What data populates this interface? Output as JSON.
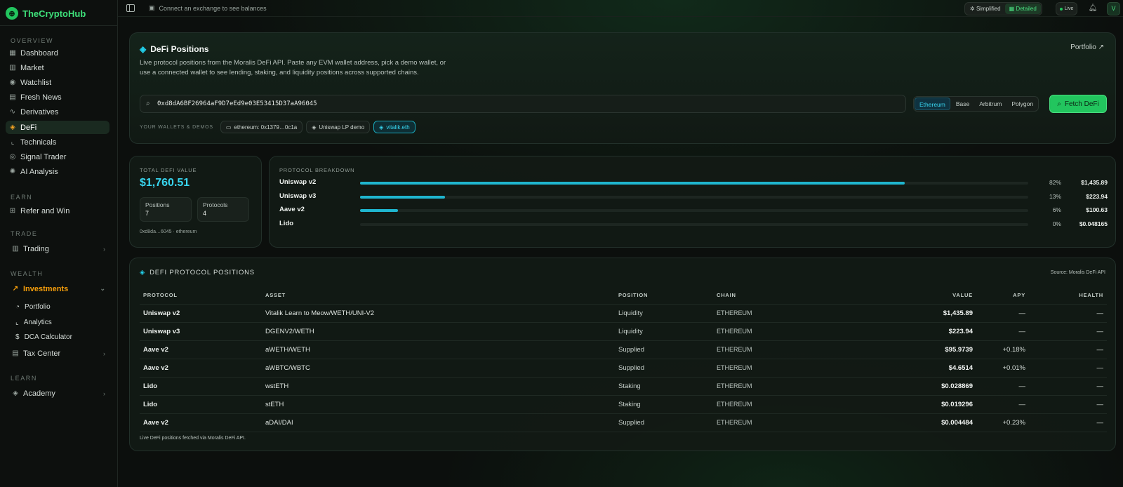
{
  "app": {
    "name": "TheCryptoHub",
    "logo_glyph": "⊕"
  },
  "sidebar": {
    "sections": {
      "overview": "OVERVIEW",
      "earn": "EARN",
      "trade": "TRADE",
      "wealth": "WEALTH",
      "learn": "LEARN"
    },
    "overview_items": [
      {
        "label": "Dashboard",
        "icon": "grid-icon"
      },
      {
        "label": "Market",
        "icon": "bar-chart-icon"
      },
      {
        "label": "Watchlist",
        "icon": "eye-icon"
      },
      {
        "label": "Fresh News",
        "icon": "newspaper-icon"
      },
      {
        "label": "Derivatives",
        "icon": "activity-icon"
      },
      {
        "label": "DeFi",
        "icon": "layers-icon",
        "active": true
      },
      {
        "label": "Technicals",
        "icon": "line-chart-icon"
      },
      {
        "label": "Signal Trader",
        "icon": "signal-icon"
      },
      {
        "label": "AI Analysis",
        "icon": "brain-icon"
      }
    ],
    "earn_items": [
      {
        "label": "Refer and Win",
        "icon": "gift-icon"
      }
    ],
    "trade_items": [
      {
        "label": "Trading",
        "icon": "candlestick-icon"
      }
    ],
    "wealth_items": [
      {
        "label": "Investments",
        "icon": "trending-up-icon"
      }
    ],
    "wealth_sub": [
      {
        "label": "Portfolio",
        "icon": "pie-chart-icon"
      },
      {
        "label": "Analytics",
        "icon": "chart-icon"
      },
      {
        "label": "DCA Calculator",
        "icon": "dollar-icon"
      }
    ],
    "tax_items": [
      {
        "label": "Tax Center",
        "icon": "receipt-icon"
      }
    ],
    "learn_items": [
      {
        "label": "Academy",
        "icon": "graduation-cap-icon"
      }
    ]
  },
  "topbar": {
    "connect_text": "Connect an exchange to see balances",
    "mode_simplified": "Simplified",
    "mode_detailed": "Detailed",
    "live": "Live",
    "avatar": "V"
  },
  "defi": {
    "title": "DeFi Positions",
    "portfolio_link": "Portfolio ↗",
    "description": "Live protocol positions from the Moralis DeFi API. Paste any EVM wallet address, pick a demo wallet, or use a connected wallet to see lending, staking, and liquidity positions across supported chains.",
    "search_value": "0xd8dA6BF26964aF9D7eEd9e03E53415D37aA96045",
    "chains": [
      "Ethereum",
      "Base",
      "Arbitrum",
      "Polygon"
    ],
    "active_chain": "Ethereum",
    "fetch_label": "Fetch DeFi",
    "wallets_label": "YOUR WALLETS & DEMOS",
    "wallet_chips": [
      "ethereum: 0x1379…0c1a",
      "Uniswap LP demo",
      "vitalik.eth"
    ]
  },
  "summary": {
    "label": "TOTAL DEFI VALUE",
    "value": "$1,760.51",
    "positions_label": "Positions",
    "positions_value": "7",
    "protocols_label": "Protocols",
    "protocols_value": "4",
    "footer": "0xd8da…6045 · ethereum"
  },
  "breakdown": {
    "label": "PROTOCOL BREAKDOWN",
    "rows": [
      {
        "name": "Uniswap v2",
        "pct": "82%",
        "fraction": 0.815,
        "value": "$1,435.89"
      },
      {
        "name": "Uniswap v3",
        "pct": "13%",
        "fraction": 0.127,
        "value": "$223.94"
      },
      {
        "name": "Aave v2",
        "pct": "6%",
        "fraction": 0.057,
        "value": "$100.63"
      },
      {
        "name": "Lido",
        "pct": "0%",
        "fraction": 0.0,
        "value": "$0.048165"
      }
    ]
  },
  "positions": {
    "title": "DEFI PROTOCOL POSITIONS",
    "source": "Source: Moralis DeFi API",
    "headers": {
      "protocol": "PROTOCOL",
      "asset": "ASSET",
      "position": "POSITION",
      "chain": "CHAIN",
      "value": "VALUE",
      "apy": "APY",
      "health": "HEALTH"
    },
    "rows": [
      {
        "protocol": "Uniswap v2",
        "asset": "Vitalik Learn to Meow/WETH/UNI-V2",
        "position": "Liquidity",
        "chain": "ETHEREUM",
        "value": "$1,435.89",
        "apy": "—",
        "health": "—"
      },
      {
        "protocol": "Uniswap v3",
        "asset": "DGENV2/WETH",
        "position": "Liquidity",
        "chain": "ETHEREUM",
        "value": "$223.94",
        "apy": "—",
        "health": "—"
      },
      {
        "protocol": "Aave v2",
        "asset": "aWETH/WETH",
        "position": "Supplied",
        "chain": "ETHEREUM",
        "value": "$95.9739",
        "apy": "+0.18%",
        "health": "—"
      },
      {
        "protocol": "Aave v2",
        "asset": "aWBTC/WBTC",
        "position": "Supplied",
        "chain": "ETHEREUM",
        "value": "$4.6514",
        "apy": "+0.01%",
        "health": "—"
      },
      {
        "protocol": "Lido",
        "asset": "wstETH",
        "position": "Staking",
        "chain": "ETHEREUM",
        "value": "$0.028869",
        "apy": "—",
        "health": "—"
      },
      {
        "protocol": "Lido",
        "asset": "stETH",
        "position": "Staking",
        "chain": "ETHEREUM",
        "value": "$0.019296",
        "apy": "—",
        "health": "—"
      },
      {
        "protocol": "Aave v2",
        "asset": "aDAI/DAI",
        "position": "Supplied",
        "chain": "ETHEREUM",
        "value": "$0.004484",
        "apy": "+0.23%",
        "health": "—"
      }
    ],
    "footer": "Live DeFi positions fetched via Moralis DeFi API."
  },
  "colors": {
    "accent_green": "#22c55e",
    "accent_cyan": "#38d6f0",
    "investments_orange": "#f59e0b"
  }
}
